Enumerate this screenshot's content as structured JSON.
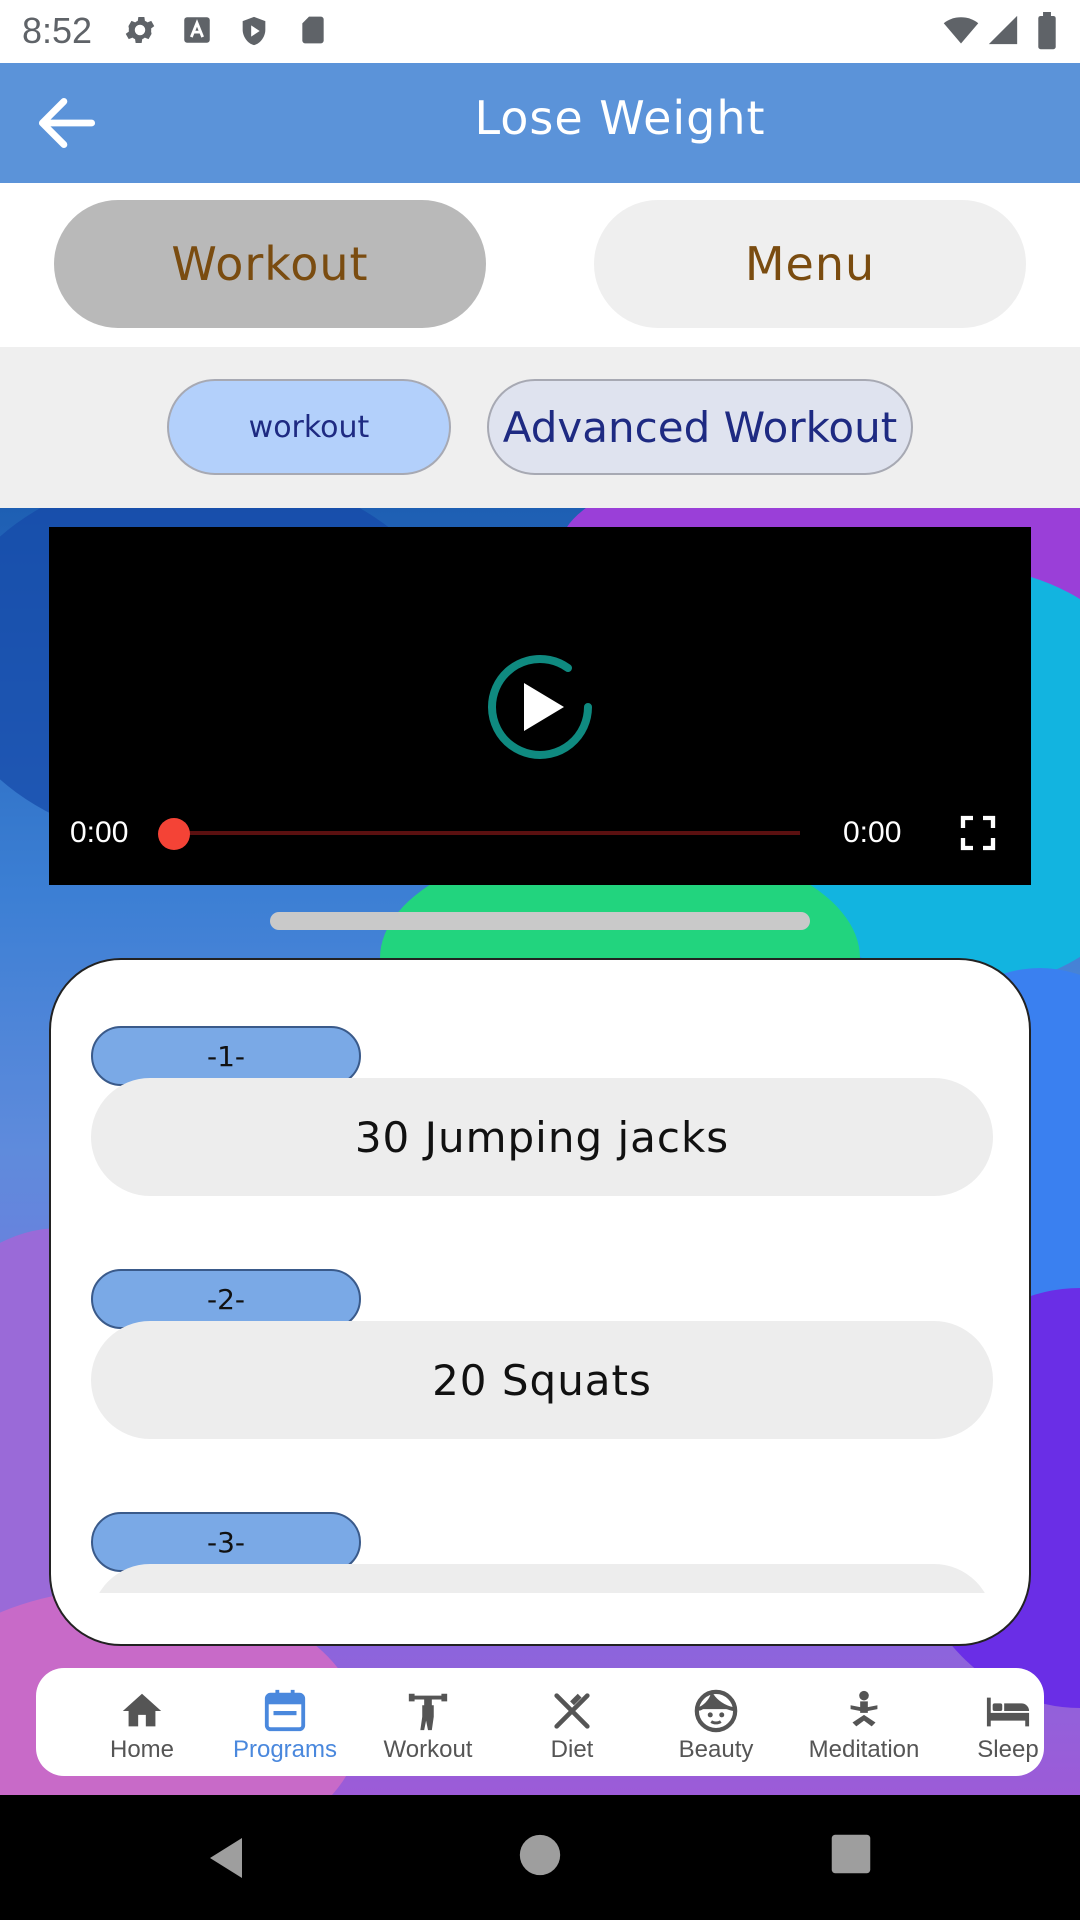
{
  "status_bar": {
    "time": "8:52"
  },
  "app_bar": {
    "title": "Lose Weight"
  },
  "segments": {
    "workout": "Workout",
    "menu": "Menu"
  },
  "chips": {
    "workout": "workout",
    "advanced": "Advanced Workout"
  },
  "video": {
    "current_time": "0:00",
    "duration": "0:00",
    "progress": 0
  },
  "exercises": [
    {
      "number": "-1-",
      "name": "30 Jumping jacks"
    },
    {
      "number": "-2-",
      "name": "20 Squats"
    },
    {
      "number": "-3-",
      "name": ""
    }
  ],
  "bottom_nav": [
    {
      "label": "Home",
      "icon": "home-icon"
    },
    {
      "label": "Programs",
      "icon": "calendar-icon",
      "active": true
    },
    {
      "label": "Workout",
      "icon": "weightlifter-icon"
    },
    {
      "label": "Diet",
      "icon": "utensils-icon"
    },
    {
      "label": "Beauty",
      "icon": "face-icon"
    },
    {
      "label": "Meditation",
      "icon": "meditation-icon"
    },
    {
      "label": "Sleep",
      "icon": "bed-icon"
    }
  ],
  "colors": {
    "app_bar": "#5b93d9",
    "accent": "#4a88dd",
    "segment_text": "#7a4c10",
    "chip_text": "#1e2a82",
    "seek_knob": "#f44336"
  }
}
